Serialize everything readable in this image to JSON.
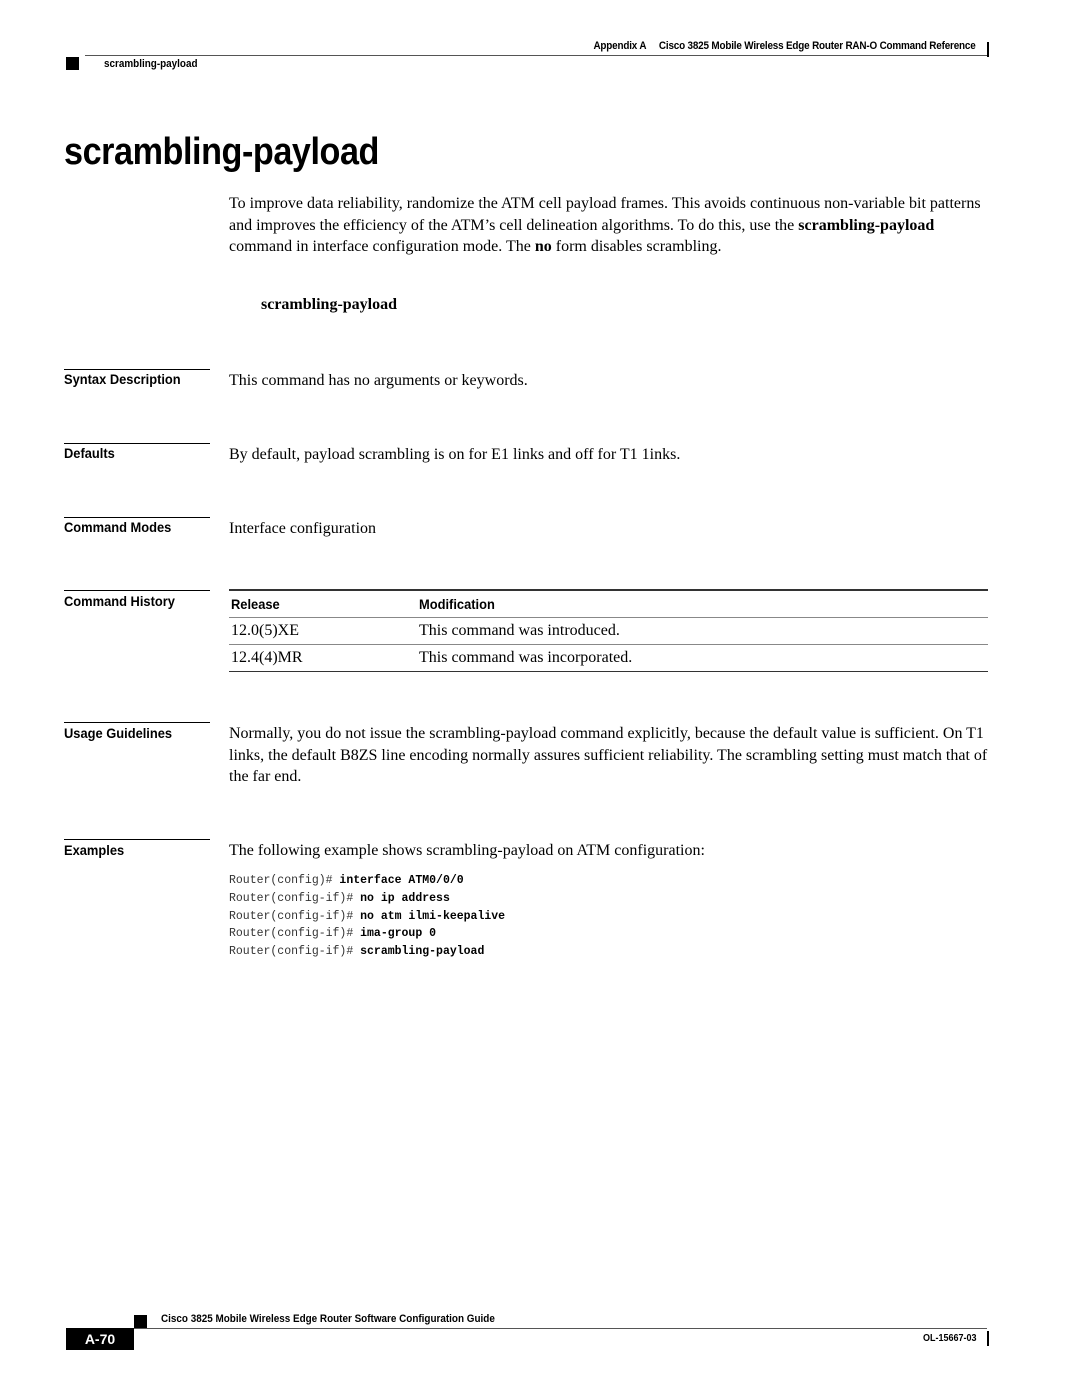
{
  "header": {
    "appendix": "Appendix A",
    "chapter_title": "Cisco 3825 Mobile Wireless Edge Router RAN-O Command Reference",
    "section": "scrambling-payload"
  },
  "title": "scrambling-payload",
  "intro": {
    "part1": "To improve data reliability, randomize the ATM cell payload frames. This avoids continuous non-variable bit patterns and improves the efficiency of the ATM’s cell delineation algorithms. To do this, use the ",
    "bold1": "scrambling-payload",
    "part2": " command in interface configuration mode. The ",
    "bold2": "no",
    "part3": " form disables scrambling."
  },
  "syntax_command": "scrambling-payload",
  "sections": {
    "syntax_description": {
      "label": "Syntax Description",
      "text": "This command has no arguments or keywords."
    },
    "defaults": {
      "label": "Defaults",
      "text": "By default, payload scrambling is on for E1 links and off for T1 1inks."
    },
    "command_modes": {
      "label": "Command Modes",
      "text": "Interface configuration"
    },
    "command_history": {
      "label": "Command History",
      "columns": [
        "Release",
        "Modification"
      ],
      "rows": [
        [
          "12.0(5)XE",
          "This command was introduced."
        ],
        [
          "12.4(4)MR",
          "This command was incorporated."
        ]
      ]
    },
    "usage_guidelines": {
      "label": "Usage Guidelines",
      "text": "Normally, you do not issue the scrambling-payload command explicitly, because the default value is sufficient. On T1 links, the default B8ZS line encoding normally assures sufficient reliability. The scrambling setting must match that of the far end."
    },
    "examples": {
      "label": "Examples",
      "text": "The following example shows scrambling-payload on ATM configuration:",
      "code": [
        {
          "prompt": "Router(config)# ",
          "cmd": "interface ATM0/0/0"
        },
        {
          "prompt": "Router(config-if)# ",
          "cmd": "no ip address"
        },
        {
          "prompt": "Router(config-if)# ",
          "cmd": "no atm ilmi-keepalive"
        },
        {
          "prompt": "Router(config-if)# ",
          "cmd": "ima-group 0"
        },
        {
          "prompt": "Router(config-if)# ",
          "cmd": "scrambling-payload"
        }
      ]
    }
  },
  "footer": {
    "guide_title": "Cisco 3825 Mobile Wireless Edge Router Software Configuration Guide",
    "page_number": "A-70",
    "doc_number": "OL-15667-03"
  }
}
